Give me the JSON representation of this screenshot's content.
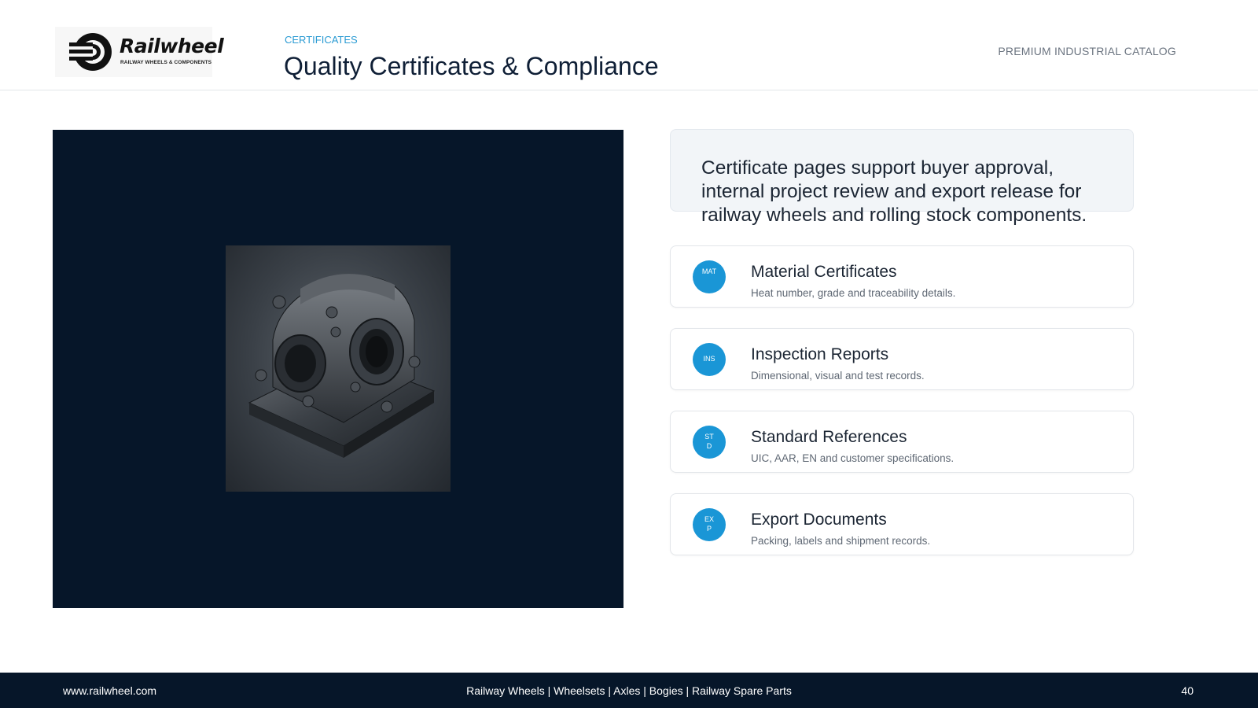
{
  "header": {
    "logo": {
      "name": "Railwheel",
      "tagline": "RAILWAY WHEELS & COMPONENTS"
    },
    "eyebrow": "CERTIFICATES",
    "title": "Quality Certificates & Compliance",
    "catalog_label": "PREMIUM INDUSTRIAL CATALOG"
  },
  "intro": {
    "text": "Certificate pages support buyer approval, internal project review and export release for railway wheels and rolling stock components."
  },
  "cards": [
    {
      "badge": "MAT",
      "title": "Material Certificates",
      "description": "Heat number, grade and traceability details."
    },
    {
      "badge": "INS",
      "title": "Inspection Reports",
      "description": "Dimensional, visual and test records."
    },
    {
      "badge": "STD",
      "title": "Standard References",
      "description": "UIC, AAR, EN and customer specifications."
    },
    {
      "badge": "EXP",
      "title": "Export Documents",
      "description": "Packing, labels and shipment records."
    }
  ],
  "footer": {
    "website": "www.railwheel.com",
    "products": "Railway Wheels | Wheelsets | Axles | Bogies | Railway Spare Parts",
    "page_number": "40"
  },
  "colors": {
    "navy": "#061629",
    "accent_blue": "#1a96d6",
    "eyebrow_blue": "#2b9bd3"
  }
}
